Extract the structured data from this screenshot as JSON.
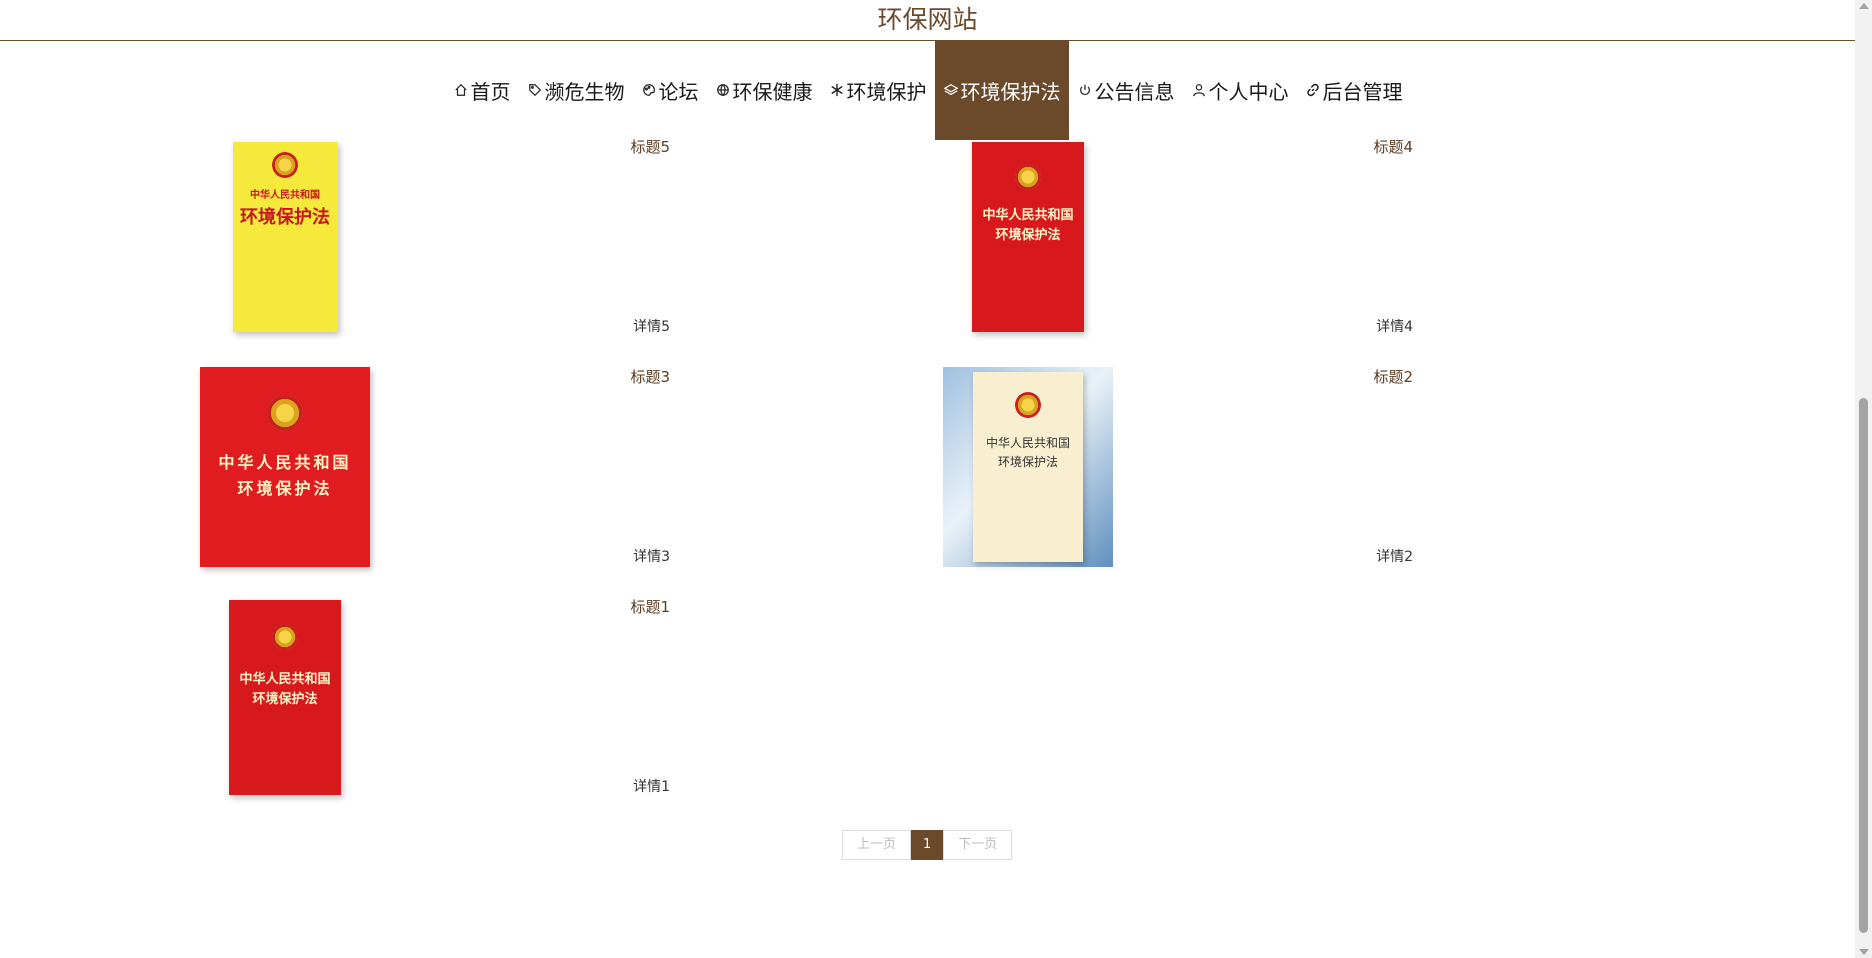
{
  "site": {
    "title": "环保网站"
  },
  "nav": [
    {
      "label": "首页",
      "icon": "home-icon"
    },
    {
      "label": "濒危生物",
      "icon": "tag-icon"
    },
    {
      "label": "论坛",
      "icon": "palette-icon"
    },
    {
      "label": "环保健康",
      "icon": "globe-icon"
    },
    {
      "label": "环境保护",
      "icon": "snowflake-icon"
    },
    {
      "label": "环境保护法",
      "icon": "layers-icon",
      "active": true
    },
    {
      "label": "公告信息",
      "icon": "power-icon"
    },
    {
      "label": "个人中心",
      "icon": "user-icon"
    },
    {
      "label": "后台管理",
      "icon": "link-icon"
    }
  ],
  "cards": [
    {
      "title": "标题5",
      "detail": "详情5",
      "cover_style": "yellow",
      "cover_text": [
        "中华人民共和国",
        "环境保护法"
      ]
    },
    {
      "title": "标题4",
      "detail": "详情4",
      "cover_style": "red",
      "cover_text": [
        "中华人民共和国",
        "环境保护法"
      ]
    },
    {
      "title": "标题3",
      "detail": "详情3",
      "cover_style": "red-wide",
      "cover_text": [
        "中华人民共和国",
        "环境保护法"
      ]
    },
    {
      "title": "标题2",
      "detail": "详情2",
      "cover_style": "cream",
      "cover_text": [
        "中华人民共和国",
        "环境保护法"
      ]
    },
    {
      "title": "标题1",
      "detail": "详情1",
      "cover_style": "red",
      "cover_text": [
        "中华人民共和国",
        "环境保护法"
      ]
    }
  ],
  "pagination": {
    "prev": "上一页",
    "current": "1",
    "next": "下一页"
  },
  "colors": {
    "accent": "#6b4a2b",
    "title_text": "#5a3d22",
    "book_red": "#d7191d",
    "book_yellow": "#f5ea3c"
  }
}
